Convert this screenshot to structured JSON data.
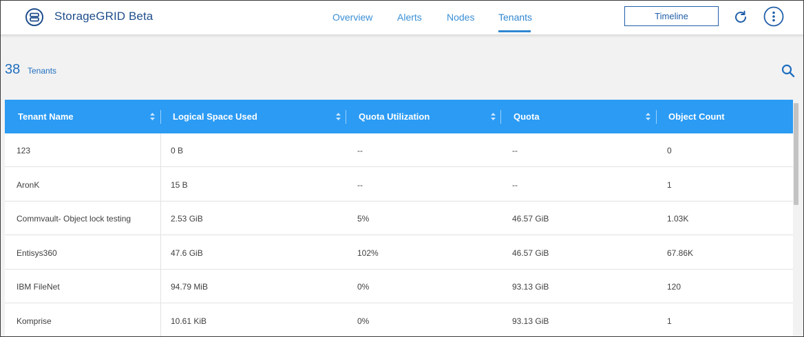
{
  "app": {
    "title": "StorageGRID Beta"
  },
  "nav": {
    "tabs": [
      {
        "label": "Overview"
      },
      {
        "label": "Alerts"
      },
      {
        "label": "Nodes"
      },
      {
        "label": "Tenants"
      }
    ],
    "active": "Tenants"
  },
  "toolbar": {
    "timeline_label": "Timeline",
    "refresh_icon": "refresh-icon",
    "more_icon": "more-vertical-icon"
  },
  "summary": {
    "count": "38",
    "label": "Tenants",
    "search_icon": "search-icon"
  },
  "colors": {
    "accent": "#2f86d0",
    "header_bg": "#2b9bf4",
    "brand_dark": "#1f4e8c"
  },
  "table": {
    "columns": [
      "Tenant Name",
      "Logical Space Used",
      "Quota Utilization",
      "Quota",
      "Object Count"
    ],
    "rows": [
      [
        "123",
        "0 B",
        "--",
        "--",
        "0"
      ],
      [
        "AronK",
        "15 B",
        "--",
        "--",
        "1"
      ],
      [
        "Commvault- Object lock testing",
        "2.53 GiB",
        "5%",
        "46.57 GiB",
        "1.03K"
      ],
      [
        "Entisys360",
        "47.6 GiB",
        "102%",
        "46.57 GiB",
        "67.86K"
      ],
      [
        "IBM FileNet",
        "94.79 MiB",
        "0%",
        "93.13 GiB",
        "120"
      ],
      [
        "Komprise",
        "10.61 KiB",
        "0%",
        "93.13 GiB",
        "1"
      ]
    ]
  }
}
